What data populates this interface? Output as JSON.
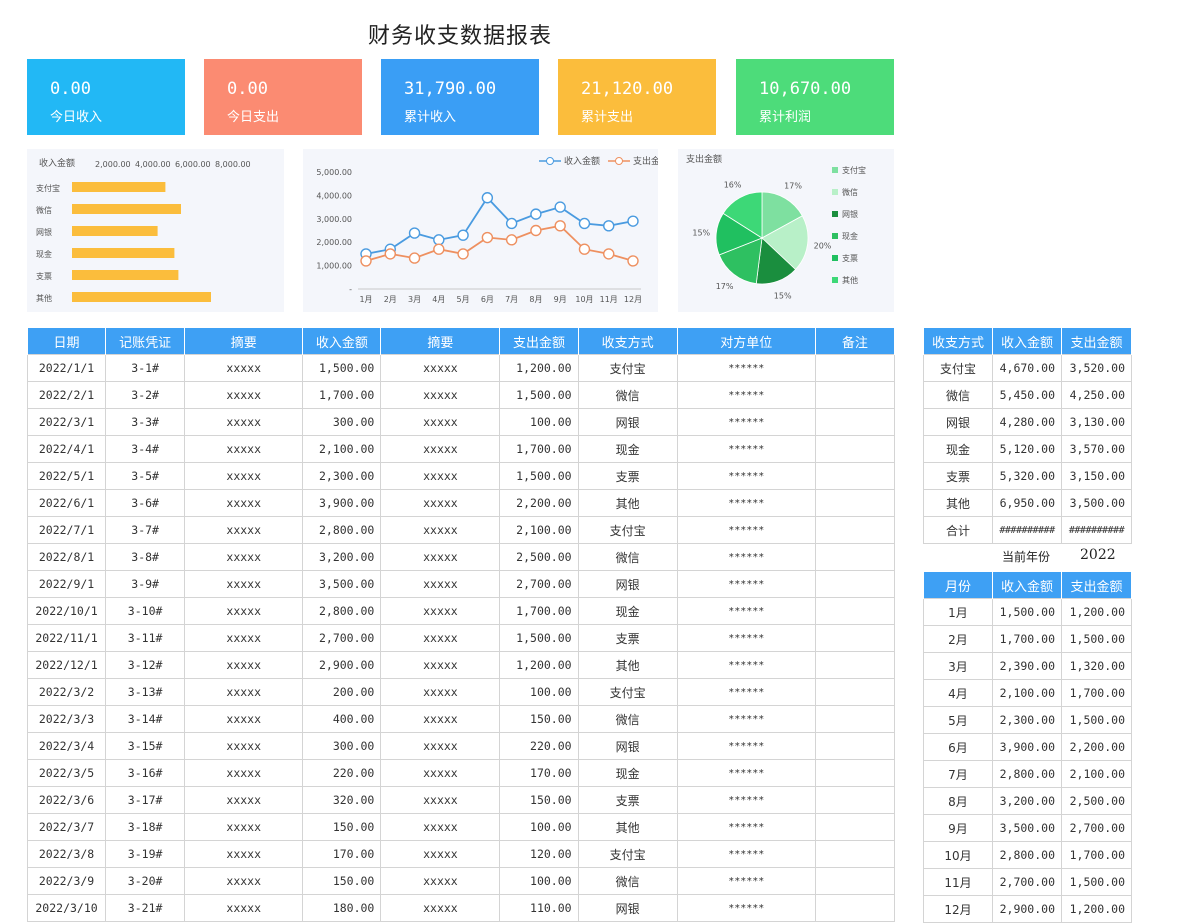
{
  "title": "财务收支数据报表",
  "cards": [
    {
      "value": "0.00",
      "label": "今日收入",
      "color": "#22b8f5"
    },
    {
      "value": "0.00",
      "label": "今日支出",
      "color": "#fb8b72"
    },
    {
      "value": "31,790.00",
      "label": "累计收入",
      "color": "#3a9ef5"
    },
    {
      "value": "21,120.00",
      "label": "累计支出",
      "color": "#fbbd3c"
    },
    {
      "value": "10,670.00",
      "label": "累计利润",
      "color": "#4ddc7a"
    }
  ],
  "bar_chart": {
    "title": "收入金额",
    "ticks": [
      "2,000.00",
      "4,000.00",
      "6,000.00",
      "8,000.00"
    ],
    "color": "#fbbd3c"
  },
  "line_chart": {
    "legend": [
      "收入金额",
      "支出金额"
    ],
    "legend_visible": [
      "收入金额",
      "支出金"
    ],
    "yticks": [
      "5,000.00",
      "4,000.00",
      "3,000.00",
      "2,000.00",
      "1,000.00",
      "-"
    ],
    "colors": [
      "#4a9be0",
      "#ee9060"
    ]
  },
  "pie_chart": {
    "title": "支出金额",
    "colors": [
      "#7ee0a0",
      "#b8f0c8",
      "#1a8e3e",
      "#2ec061",
      "#20c060",
      "#3dd877"
    ]
  },
  "chart_data": [
    {
      "type": "bar",
      "title": "收入金额",
      "categories": [
        "支付宝",
        "微信",
        "网银",
        "现金",
        "支票",
        "其他"
      ],
      "values": [
        4670,
        5450,
        4280,
        5120,
        5320,
        6950
      ],
      "xlim": [
        0,
        8000
      ]
    },
    {
      "type": "line",
      "x": [
        "1月",
        "2月",
        "3月",
        "4月",
        "5月",
        "6月",
        "7月",
        "8月",
        "9月",
        "10月",
        "11月",
        "12月"
      ],
      "series": [
        {
          "name": "收入金额",
          "values": [
            1500,
            1700,
            2390,
            2100,
            2300,
            3900,
            2800,
            3200,
            3500,
            2800,
            2700,
            2900
          ]
        },
        {
          "name": "支出金额",
          "values": [
            1200,
            1500,
            1320,
            1700,
            1500,
            2200,
            2100,
            2500,
            2700,
            1700,
            1500,
            1200
          ]
        }
      ],
      "ylim": [
        0,
        5000
      ]
    },
    {
      "type": "pie",
      "title": "支出金额",
      "categories": [
        "支付宝",
        "微信",
        "网银",
        "现金",
        "支票",
        "其他"
      ],
      "values": [
        17,
        20,
        15,
        17,
        15,
        16
      ],
      "labels": [
        "17%",
        "20%",
        "15%",
        "17%",
        "15%",
        "16%"
      ]
    }
  ],
  "main_table": {
    "headers": [
      "日期",
      "记账凭证",
      "摘要",
      "收入金额",
      "摘要",
      "支出金额",
      "收支方式",
      "对方单位",
      "备注"
    ],
    "rows": [
      [
        "2022/1/1",
        "3-1#",
        "xxxxx",
        "1,500.00",
        "xxxxx",
        "1,200.00",
        "支付宝",
        "******",
        ""
      ],
      [
        "2022/2/1",
        "3-2#",
        "xxxxx",
        "1,700.00",
        "xxxxx",
        "1,500.00",
        "微信",
        "******",
        ""
      ],
      [
        "2022/3/1",
        "3-3#",
        "xxxxx",
        "300.00",
        "xxxxx",
        "100.00",
        "网银",
        "******",
        ""
      ],
      [
        "2022/4/1",
        "3-4#",
        "xxxxx",
        "2,100.00",
        "xxxxx",
        "1,700.00",
        "现金",
        "******",
        ""
      ],
      [
        "2022/5/1",
        "3-5#",
        "xxxxx",
        "2,300.00",
        "xxxxx",
        "1,500.00",
        "支票",
        "******",
        ""
      ],
      [
        "2022/6/1",
        "3-6#",
        "xxxxx",
        "3,900.00",
        "xxxxx",
        "2,200.00",
        "其他",
        "******",
        ""
      ],
      [
        "2022/7/1",
        "3-7#",
        "xxxxx",
        "2,800.00",
        "xxxxx",
        "2,100.00",
        "支付宝",
        "******",
        ""
      ],
      [
        "2022/8/1",
        "3-8#",
        "xxxxx",
        "3,200.00",
        "xxxxx",
        "2,500.00",
        "微信",
        "******",
        ""
      ],
      [
        "2022/9/1",
        "3-9#",
        "xxxxx",
        "3,500.00",
        "xxxxx",
        "2,700.00",
        "网银",
        "******",
        ""
      ],
      [
        "2022/10/1",
        "3-10#",
        "xxxxx",
        "2,800.00",
        "xxxxx",
        "1,700.00",
        "现金",
        "******",
        ""
      ],
      [
        "2022/11/1",
        "3-11#",
        "xxxxx",
        "2,700.00",
        "xxxxx",
        "1,500.00",
        "支票",
        "******",
        ""
      ],
      [
        "2022/12/1",
        "3-12#",
        "xxxxx",
        "2,900.00",
        "xxxxx",
        "1,200.00",
        "其他",
        "******",
        ""
      ],
      [
        "2022/3/2",
        "3-13#",
        "xxxxx",
        "200.00",
        "xxxxx",
        "100.00",
        "支付宝",
        "******",
        ""
      ],
      [
        "2022/3/3",
        "3-14#",
        "xxxxx",
        "400.00",
        "xxxxx",
        "150.00",
        "微信",
        "******",
        ""
      ],
      [
        "2022/3/4",
        "3-15#",
        "xxxxx",
        "300.00",
        "xxxxx",
        "220.00",
        "网银",
        "******",
        ""
      ],
      [
        "2022/3/5",
        "3-16#",
        "xxxxx",
        "220.00",
        "xxxxx",
        "170.00",
        "现金",
        "******",
        ""
      ],
      [
        "2022/3/6",
        "3-17#",
        "xxxxx",
        "320.00",
        "xxxxx",
        "150.00",
        "支票",
        "******",
        ""
      ],
      [
        "2022/3/7",
        "3-18#",
        "xxxxx",
        "150.00",
        "xxxxx",
        "100.00",
        "其他",
        "******",
        ""
      ],
      [
        "2022/3/8",
        "3-19#",
        "xxxxx",
        "170.00",
        "xxxxx",
        "120.00",
        "支付宝",
        "******",
        ""
      ],
      [
        "2022/3/9",
        "3-20#",
        "xxxxx",
        "150.00",
        "xxxxx",
        "100.00",
        "微信",
        "******",
        ""
      ],
      [
        "2022/3/10",
        "3-21#",
        "xxxxx",
        "180.00",
        "xxxxx",
        "110.00",
        "网银",
        "******",
        ""
      ]
    ]
  },
  "method_table": {
    "headers": [
      "收支方式",
      "收入金额",
      "支出金额"
    ],
    "rows": [
      [
        "支付宝",
        "4,670.00",
        "3,520.00"
      ],
      [
        "微信",
        "5,450.00",
        "4,250.00"
      ],
      [
        "网银",
        "4,280.00",
        "3,130.00"
      ],
      [
        "现金",
        "5,120.00",
        "3,570.00"
      ],
      [
        "支票",
        "5,320.00",
        "3,150.00"
      ],
      [
        "其他",
        "6,950.00",
        "3,500.00"
      ],
      [
        "合计",
        "##########",
        "##########"
      ]
    ]
  },
  "year": {
    "label": "当前年份",
    "value": "2022"
  },
  "month_table": {
    "headers": [
      "月份",
      "收入金额",
      "支出金额"
    ],
    "rows": [
      [
        "1月",
        "1,500.00",
        "1,200.00"
      ],
      [
        "2月",
        "1,700.00",
        "1,500.00"
      ],
      [
        "3月",
        "2,390.00",
        "1,320.00"
      ],
      [
        "4月",
        "2,100.00",
        "1,700.00"
      ],
      [
        "5月",
        "2,300.00",
        "1,500.00"
      ],
      [
        "6月",
        "3,900.00",
        "2,200.00"
      ],
      [
        "7月",
        "2,800.00",
        "2,100.00"
      ],
      [
        "8月",
        "3,200.00",
        "2,500.00"
      ],
      [
        "9月",
        "3,500.00",
        "2,700.00"
      ],
      [
        "10月",
        "2,800.00",
        "1,700.00"
      ],
      [
        "11月",
        "2,700.00",
        "1,500.00"
      ],
      [
        "12月",
        "2,900.00",
        "1,200.00"
      ]
    ]
  }
}
